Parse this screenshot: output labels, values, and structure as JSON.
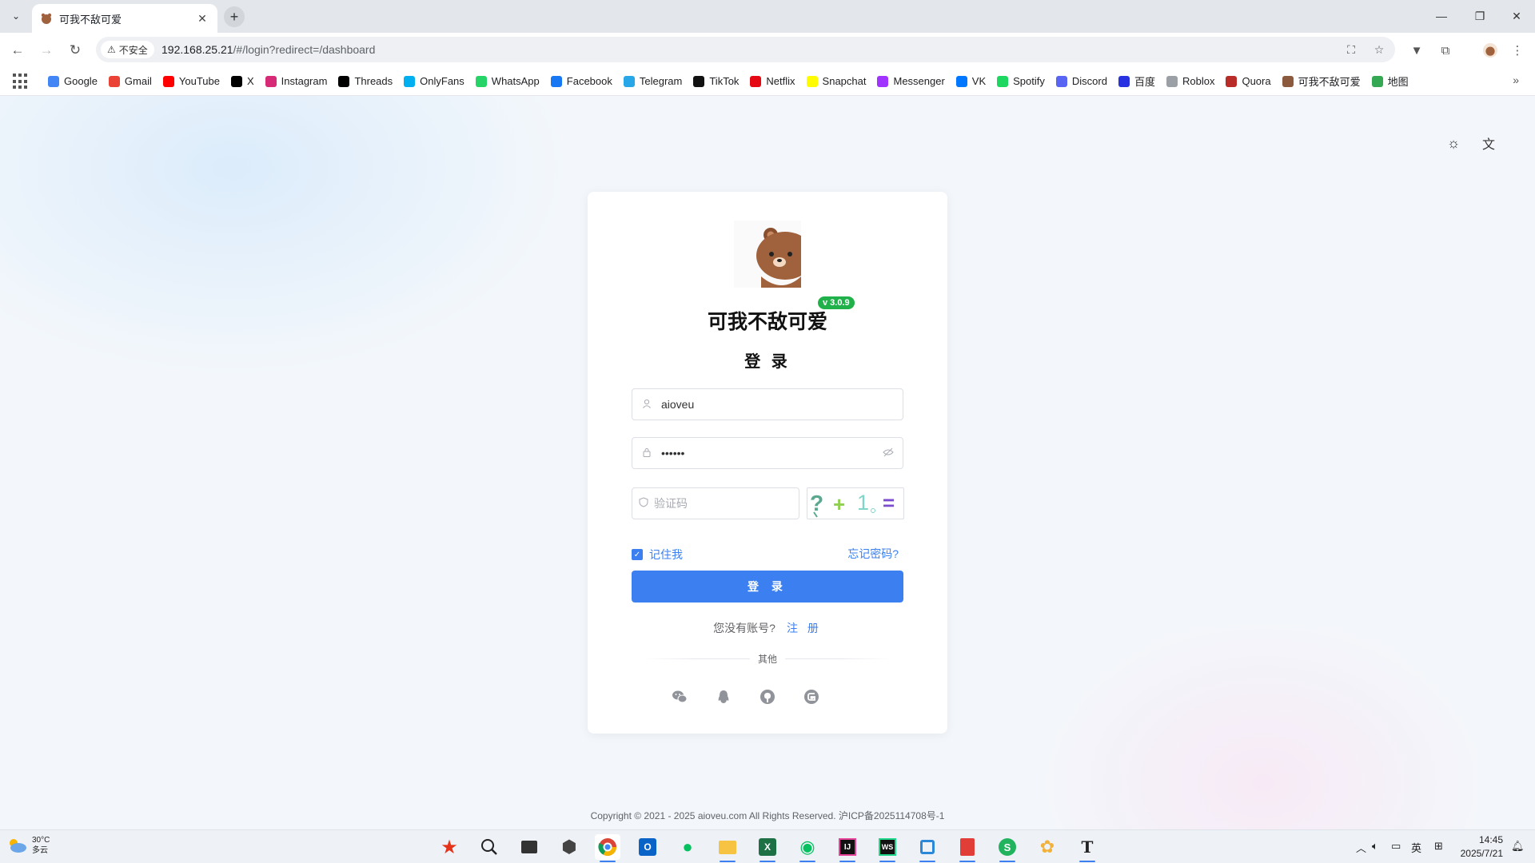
{
  "browser": {
    "tab_title": "可我不敌可爱",
    "url_host": "192.168.25.21",
    "url_path": "/#/login?redirect=/dashboard",
    "security_label": "不安全",
    "bookmarks": [
      {
        "label": "Google",
        "icon": "google-icon",
        "color": "#4285f4"
      },
      {
        "label": "Gmail",
        "icon": "gmail-icon",
        "color": "#ea4335"
      },
      {
        "label": "YouTube",
        "icon": "youtube-icon",
        "color": "#ff0000"
      },
      {
        "label": "X",
        "icon": "x-icon",
        "color": "#000000"
      },
      {
        "label": "Instagram",
        "icon": "instagram-icon",
        "color": "#d62976"
      },
      {
        "label": "Threads",
        "icon": "threads-icon",
        "color": "#000000"
      },
      {
        "label": "OnlyFans",
        "icon": "onlyfans-icon",
        "color": "#00aff0"
      },
      {
        "label": "WhatsApp",
        "icon": "whatsapp-icon",
        "color": "#25d366"
      },
      {
        "label": "Facebook",
        "icon": "facebook-icon",
        "color": "#1877f2"
      },
      {
        "label": "Telegram",
        "icon": "telegram-icon",
        "color": "#27a7e7"
      },
      {
        "label": "TikTok",
        "icon": "tiktok-icon",
        "color": "#111111"
      },
      {
        "label": "Netflix",
        "icon": "netflix-icon",
        "color": "#e50914"
      },
      {
        "label": "Snapchat",
        "icon": "snapchat-icon",
        "color": "#fffc00"
      },
      {
        "label": "Messenger",
        "icon": "messenger-icon",
        "color": "#a033ff"
      },
      {
        "label": "VK",
        "icon": "vk-icon",
        "color": "#0077ff"
      },
      {
        "label": "Spotify",
        "icon": "spotify-icon",
        "color": "#1ed760"
      },
      {
        "label": "Discord",
        "icon": "discord-icon",
        "color": "#5865f2"
      },
      {
        "label": "百度",
        "icon": "baidu-icon",
        "color": "#2932e1"
      },
      {
        "label": "Roblox",
        "icon": "roblox-icon",
        "color": "#9aa0a6"
      },
      {
        "label": "Quora",
        "icon": "quora-icon",
        "color": "#b92b27"
      },
      {
        "label": "可我不敌可爱",
        "icon": "bear-icon",
        "color": "#8b5a3c"
      },
      {
        "label": "地图",
        "icon": "maps-icon",
        "color": "#34a853"
      }
    ]
  },
  "login": {
    "version_badge": "v 3.0.9",
    "brand_name": "可我不敌可爱",
    "title": "登 录",
    "username_value": "aioveu",
    "password_value": "••••••",
    "captcha_placeholder": "验证码",
    "captcha_text": [
      "?",
      "+",
      "1",
      "="
    ],
    "remember_label": "记住我",
    "remember_checked": true,
    "forgot_label": "忘记密码?",
    "submit_label": "登 录",
    "no_account_text": "您没有账号?",
    "register_label": "注 册",
    "other_label": "其他",
    "social": [
      "wechat-icon",
      "qq-icon",
      "github-icon",
      "gitee-icon"
    ],
    "accent_color": "#3b7ff0"
  },
  "footer": {
    "copyright": "Copyright © 2021 - 2025 aioveu.com All Rights Reserved. 沪ICP备2025114708号-1"
  },
  "taskbar": {
    "weather_temp": "30°C",
    "weather_desc": "多云",
    "ime_label": "英",
    "time": "14:45",
    "date": "2025/7/21"
  }
}
